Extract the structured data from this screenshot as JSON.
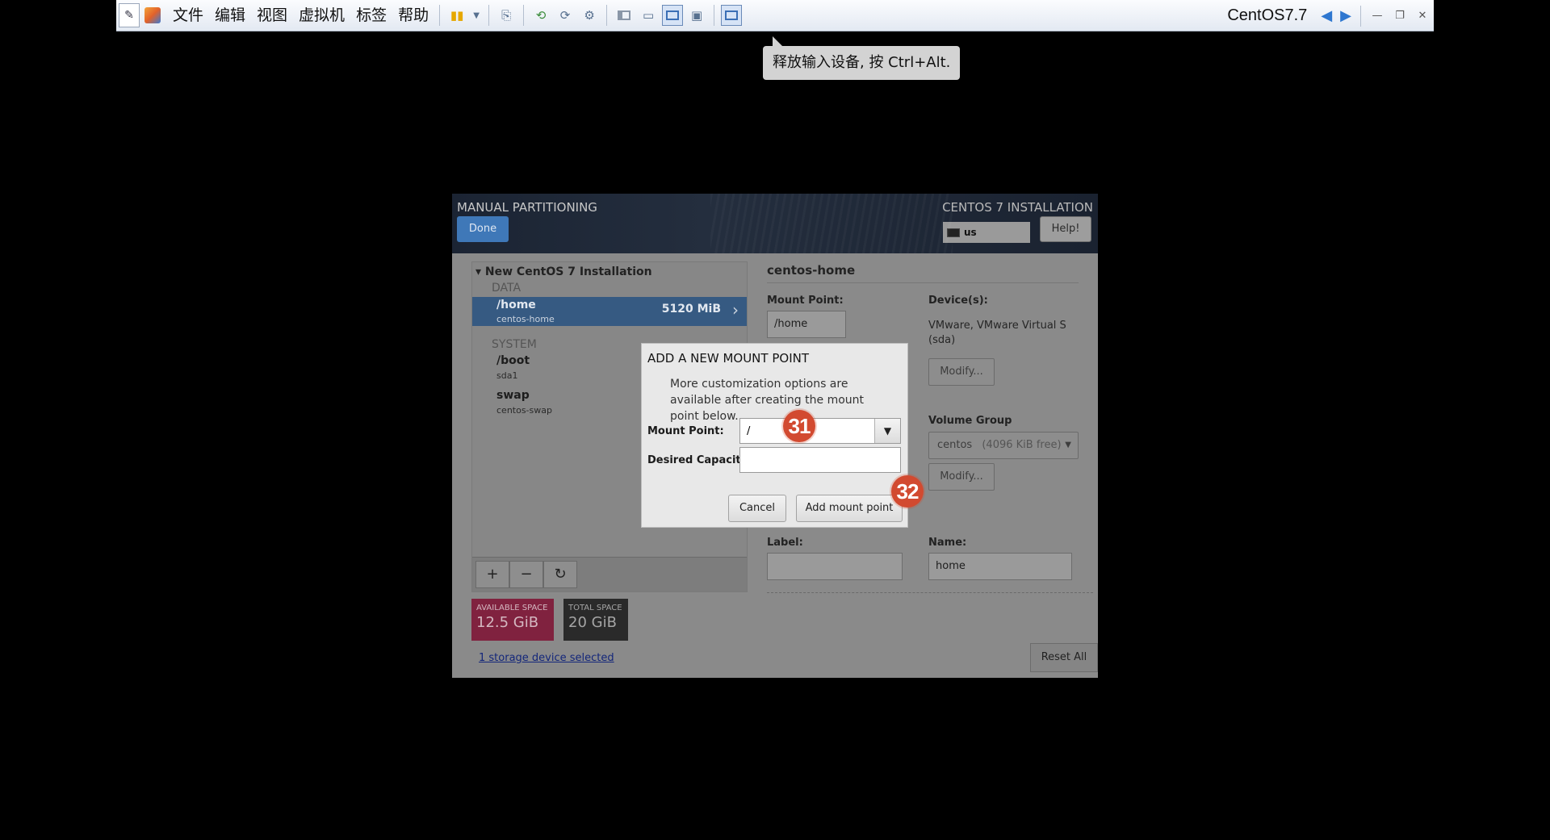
{
  "vm_toolbar": {
    "menu": [
      "文件",
      "编辑",
      "视图",
      "虚拟机",
      "标签",
      "帮助"
    ],
    "vm_name": "CentOS7.7"
  },
  "tooltip": {
    "text": "释放输入设备, 按 Ctrl+Alt."
  },
  "installer": {
    "section_title": "MANUAL PARTITIONING",
    "done_label": "Done",
    "install_title": "CENTOS 7 INSTALLATION",
    "keyboard_layout": "us",
    "help_label": "Help!",
    "tree": {
      "root_label": "New CentOS 7 Installation",
      "groups": [
        {
          "name": "DATA",
          "items": [
            {
              "mount": "/home",
              "device": "centos-home",
              "size": "5120 MiB",
              "selected": true
            }
          ]
        },
        {
          "name": "SYSTEM",
          "items": [
            {
              "mount": "/boot",
              "device": "sda1"
            },
            {
              "mount": "swap",
              "device": "centos-swap"
            }
          ]
        }
      ]
    },
    "buttons": {
      "add": "+",
      "remove": "−",
      "refresh": "↻"
    },
    "available_space": {
      "label": "AVAILABLE SPACE",
      "value": "12.5 GiB"
    },
    "total_space": {
      "label": "TOTAL SPACE",
      "value": "20 GiB"
    },
    "storage_link": "1 storage device selected",
    "reset_all": "Reset All",
    "details": {
      "title": "centos-home",
      "mount_point_label": "Mount Point:",
      "mount_point_value": "/home",
      "devices_label": "Device(s):",
      "devices_value": "VMware, VMware Virtual S (sda)",
      "modify_label": "Modify...",
      "volume_group_label": "Volume Group",
      "volume_group_name": "centos",
      "volume_group_free": "(4096 KiB free)",
      "label_label": "Label:",
      "label_value": "",
      "name_label": "Name:",
      "name_value": "home"
    }
  },
  "dialog": {
    "title": "ADD A NEW MOUNT POINT",
    "description": "More customization options are available after creating the mount point below.",
    "mount_point_label": "Mount Point:",
    "mount_point_value": "/",
    "capacity_label": "Desired Capacity:",
    "capacity_value": "",
    "cancel_label": "Cancel",
    "add_label": "Add mount point"
  },
  "annotations": {
    "badge_1": "31",
    "badge_2": "32"
  },
  "colors": {
    "selected_row": "#365a82",
    "done_button": "#3f78b8",
    "available_space": "#80223f",
    "badge": "#d24a30"
  }
}
